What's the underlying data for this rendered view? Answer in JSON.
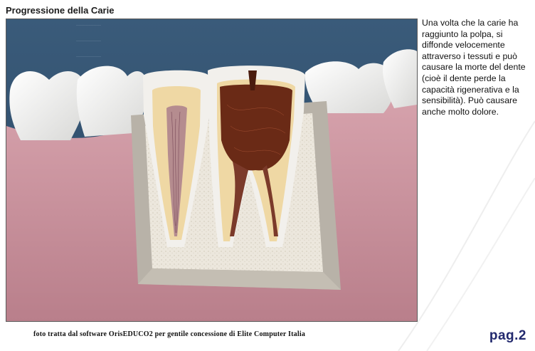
{
  "page": {
    "title": "Progressione della Carie",
    "description": "Una volta che la carie ha raggiunto la polpa, si diffonde velocemente attraverso i tessuti e può causare la morte del dente (cioè   il dente perde la capacità rigenerativa e la sensibilità). Può causare anche molto dolore.",
    "credit": "foto tratta dal software OrisEDUCO2 per gentile concessione di Elite Computer Italia",
    "page_number": "pag.2"
  },
  "colors": {
    "background": "#31506d",
    "gum": "#c9929d",
    "enamel": "#f4f4f2",
    "dentin": "#efd8a4",
    "decay": "#6a2a16",
    "bone": "#ebe6dc",
    "page_number": "#22296e"
  }
}
